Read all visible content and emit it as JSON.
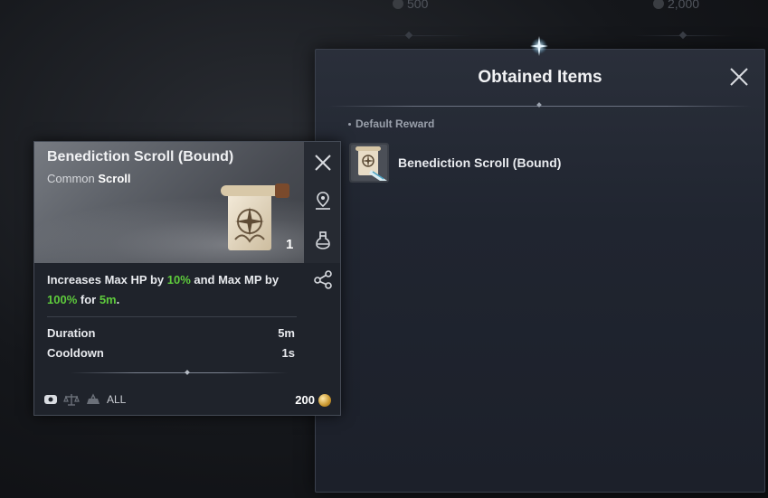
{
  "background": {
    "currency_left": "500",
    "currency_right": "2,000"
  },
  "panel": {
    "title": "Obtained Items",
    "section_label": "Default Reward",
    "items": [
      {
        "name": "Benediction Scroll (Bound)",
        "icon": "scroll-icon"
      }
    ]
  },
  "tooltip": {
    "title": "Benediction Scroll (Bound)",
    "rarity": "Common",
    "category": "Scroll",
    "quantity": "1",
    "description": {
      "p1": "Increases Max HP by ",
      "v1": "10%",
      "p2": " and Max MP by ",
      "v2": "100%",
      "p3": " for ",
      "v3": "5m",
      "p4": "."
    },
    "stats": [
      {
        "label": "Duration",
        "value": "5m"
      },
      {
        "label": "Cooldown",
        "value": "1s"
      }
    ],
    "restriction": "ALL",
    "price": "200"
  },
  "colors": {
    "highlight": "#5ecb3c",
    "panel_bg": "#202530",
    "tooltip_bg": "#1f232b"
  }
}
